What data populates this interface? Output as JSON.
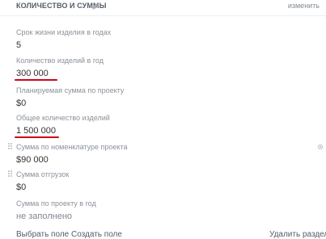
{
  "section": {
    "title": "КОЛИЧЕСТВО И СУММЫ",
    "edit_label": "изменить"
  },
  "fields": [
    {
      "label": "Срок жизни изделия в годах",
      "value": "5"
    },
    {
      "label": "Количество изделий в год",
      "value": "300 000"
    },
    {
      "label": "Планируемая сумма по проекту",
      "value": "$0"
    },
    {
      "label": "Общее количество изделий",
      "value": "1 500 000"
    },
    {
      "label": "Сумма по номенклатуре проекта",
      "value": "$90 000"
    },
    {
      "label": "Сумма отгрузок",
      "value": "$0"
    },
    {
      "label": "Сумма по проекту в год",
      "value": "не заполнено"
    }
  ],
  "footer": {
    "select_field": "Выбрать поле",
    "create_field": "Создать поле",
    "delete_section": "Удалить раздел"
  },
  "colors": {
    "underline_accent": "#d0021b",
    "label": "#8a9199",
    "value": "#333333"
  }
}
